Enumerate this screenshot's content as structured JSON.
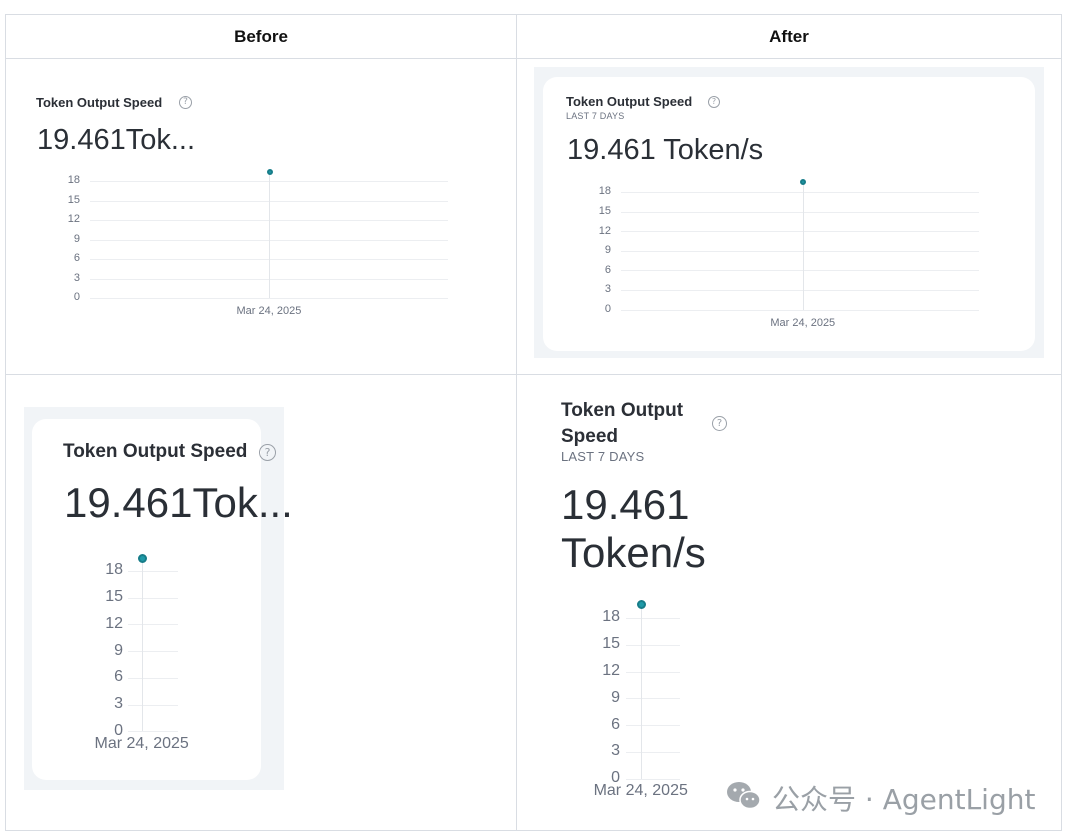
{
  "table": {
    "headers": {
      "before": "Before",
      "after": "After"
    }
  },
  "widget": {
    "title": "Token Output Speed",
    "subtitle": "LAST 7 DAYS",
    "value_truncated": "19.461Tok...",
    "value_full": "19.461 Token/s",
    "value_line1": "19.461",
    "value_line2": "Token/s",
    "title_line1": "Token Output",
    "title_line2": "Speed",
    "help_glyph": "?"
  },
  "chart_data": {
    "type": "scatter",
    "x": [
      "Mar 24, 2025"
    ],
    "y_ticks": [
      "18",
      "15",
      "12",
      "9",
      "6",
      "3",
      "0"
    ],
    "series": [
      {
        "values": [
          19.461
        ]
      }
    ],
    "ylim": [
      0,
      19.5
    ],
    "grid": true
  },
  "watermark": {
    "text": "公众号 · AgentLight",
    "icon": "wechat-icon"
  },
  "colors": {
    "point": "#1f9aa8",
    "grid": "#eceef1",
    "panel_bg": "#f1f4f7"
  }
}
